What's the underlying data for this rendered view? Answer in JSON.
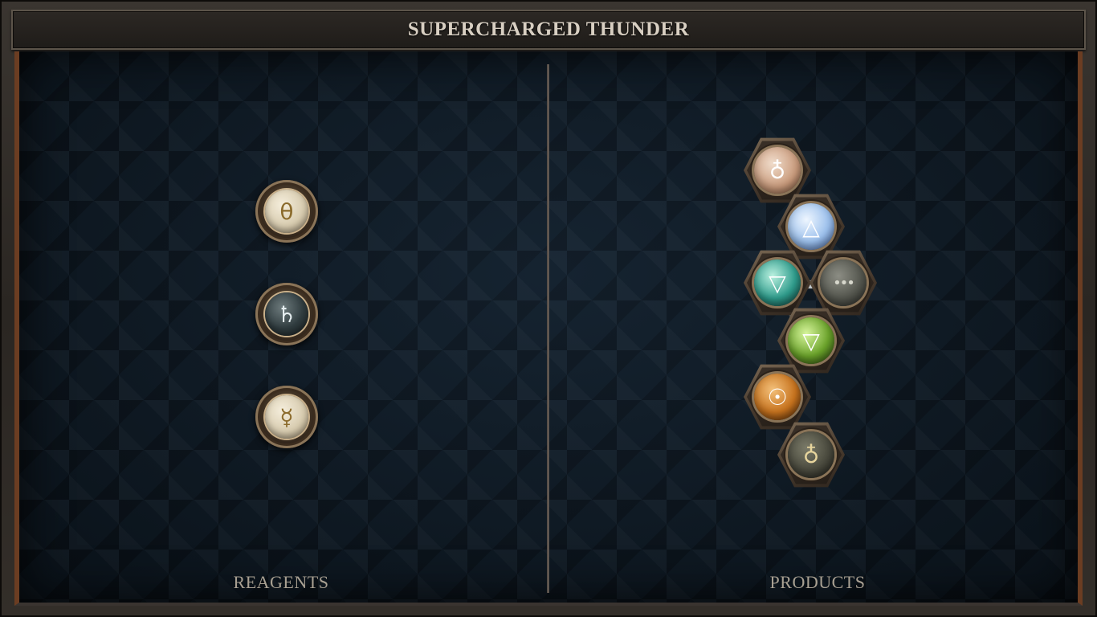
{
  "title": "SUPERCHARGED THUNDER",
  "labels": {
    "reagents": "REAGENTS",
    "products": "PRODUCTS"
  },
  "reagents": [
    {
      "icon": "salt-symbol-icon",
      "glyph": "θ",
      "style": "light"
    },
    {
      "icon": "saturn-lead-icon",
      "glyph": "♄",
      "style": "dark"
    },
    {
      "icon": "mercury-icon",
      "glyph": "☿",
      "style": "light"
    }
  ],
  "products": [
    {
      "icon": "sulfur-icon",
      "glyph": "♁",
      "color": "#d9b8a0"
    },
    {
      "icon": "air-triangle-icon",
      "glyph": "△",
      "color": "#b9d2ee"
    },
    {
      "icon": "water-triangle-icon",
      "glyph": "▽",
      "color": "#2f9c8c"
    },
    {
      "icon": "more-icon",
      "glyph": "•••",
      "color": "#55574f"
    },
    {
      "icon": "earth-triangle-icon",
      "glyph": "▽",
      "color": "#6aa22a"
    },
    {
      "icon": "sun-gold-icon",
      "glyph": "☉",
      "color": "#c7731e"
    },
    {
      "icon": "antimony-icon",
      "glyph": "♁",
      "color": "#4a4a3e"
    }
  ]
}
